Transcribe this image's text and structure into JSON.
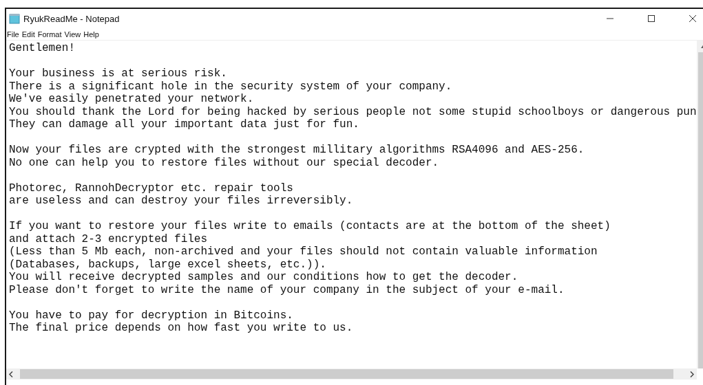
{
  "window": {
    "title": "RyukReadMe - Notepad"
  },
  "menu": [
    "File",
    "Edit",
    "Format",
    "View",
    "Help"
  ],
  "paragraphs": [
    [
      "Gentlemen!"
    ],
    [
      "Your business is at serious risk.",
      "There is a significant hole in the security system of your company.",
      "We've easily penetrated your network.",
      "You should thank the Lord for being hacked by serious people not some stupid schoolboys or dangerous pun",
      "They can damage all your important data just for fun."
    ],
    [
      "Now your files are crypted with the strongest millitary algorithms RSA4096 and AES-256.",
      "No one can help you to restore files without our special decoder."
    ],
    [
      "Photorec, RannohDecryptor etc. repair tools",
      "are useless and can destroy your files irreversibly."
    ],
    [
      "If you want to restore your files write to emails (contacts are at the bottom of the sheet)",
      "and attach 2-3 encrypted files",
      "(Less than 5 Mb each, non-archived and your files should not contain valuable information",
      "(Databases, backups, large excel sheets, etc.)).",
      "You will receive decrypted samples and our conditions how to get the decoder.",
      "Please don't forget to write the name of your company in the subject of your e-mail."
    ],
    [
      "You have to pay for decryption in Bitcoins.",
      "The final price depends on how fast you write to us."
    ]
  ]
}
